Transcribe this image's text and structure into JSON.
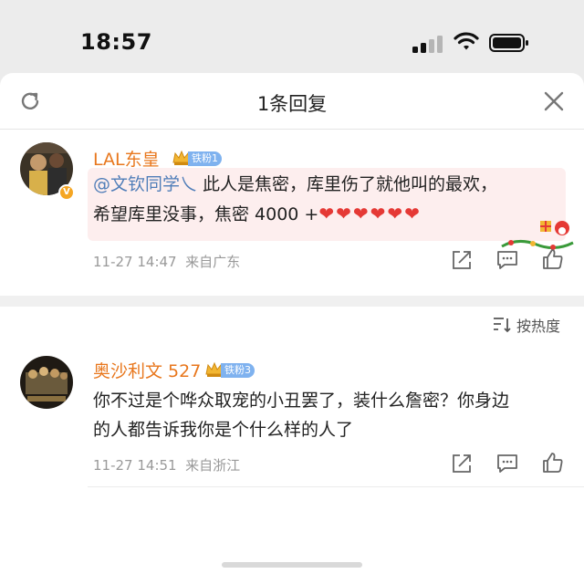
{
  "status_bar": {
    "time": "18:57"
  },
  "sheet": {
    "title": "1条回复"
  },
  "comment1": {
    "username": "LAL东皇",
    "fan_level": "铁粉1",
    "mention": "@文钦同学乀",
    "text_line1_rest": " 此人是焦密，库里伤了就他叫的最欢，",
    "text_line2": "希望库里没事，焦密 4000 +",
    "hearts": "❤❤❤❤❤❤",
    "timestamp": "11-27 14:47",
    "location": "来自广东"
  },
  "sort": {
    "label": "按热度"
  },
  "comment2": {
    "username": "奥沙利文 527",
    "fan_level": "铁粉3",
    "text_line1": "你不过是个哗众取宠的小丑罢了，装什么詹密？你身边",
    "text_line2": "的人都告诉我你是个什么样的人了",
    "timestamp": "11-27 14:51",
    "location": "来自浙江"
  },
  "icons": {
    "refresh": "refresh-icon",
    "close": "close-icon",
    "share": "share-icon",
    "comment": "comment-icon",
    "like": "thumbs-up-icon",
    "sort": "sort-icon"
  },
  "colors": {
    "username": "#e8771d",
    "mention": "#4f7db8",
    "fan_badge": "#7fb2ef",
    "highlight_bg": "#fdeeee",
    "heart": "#e53935"
  }
}
